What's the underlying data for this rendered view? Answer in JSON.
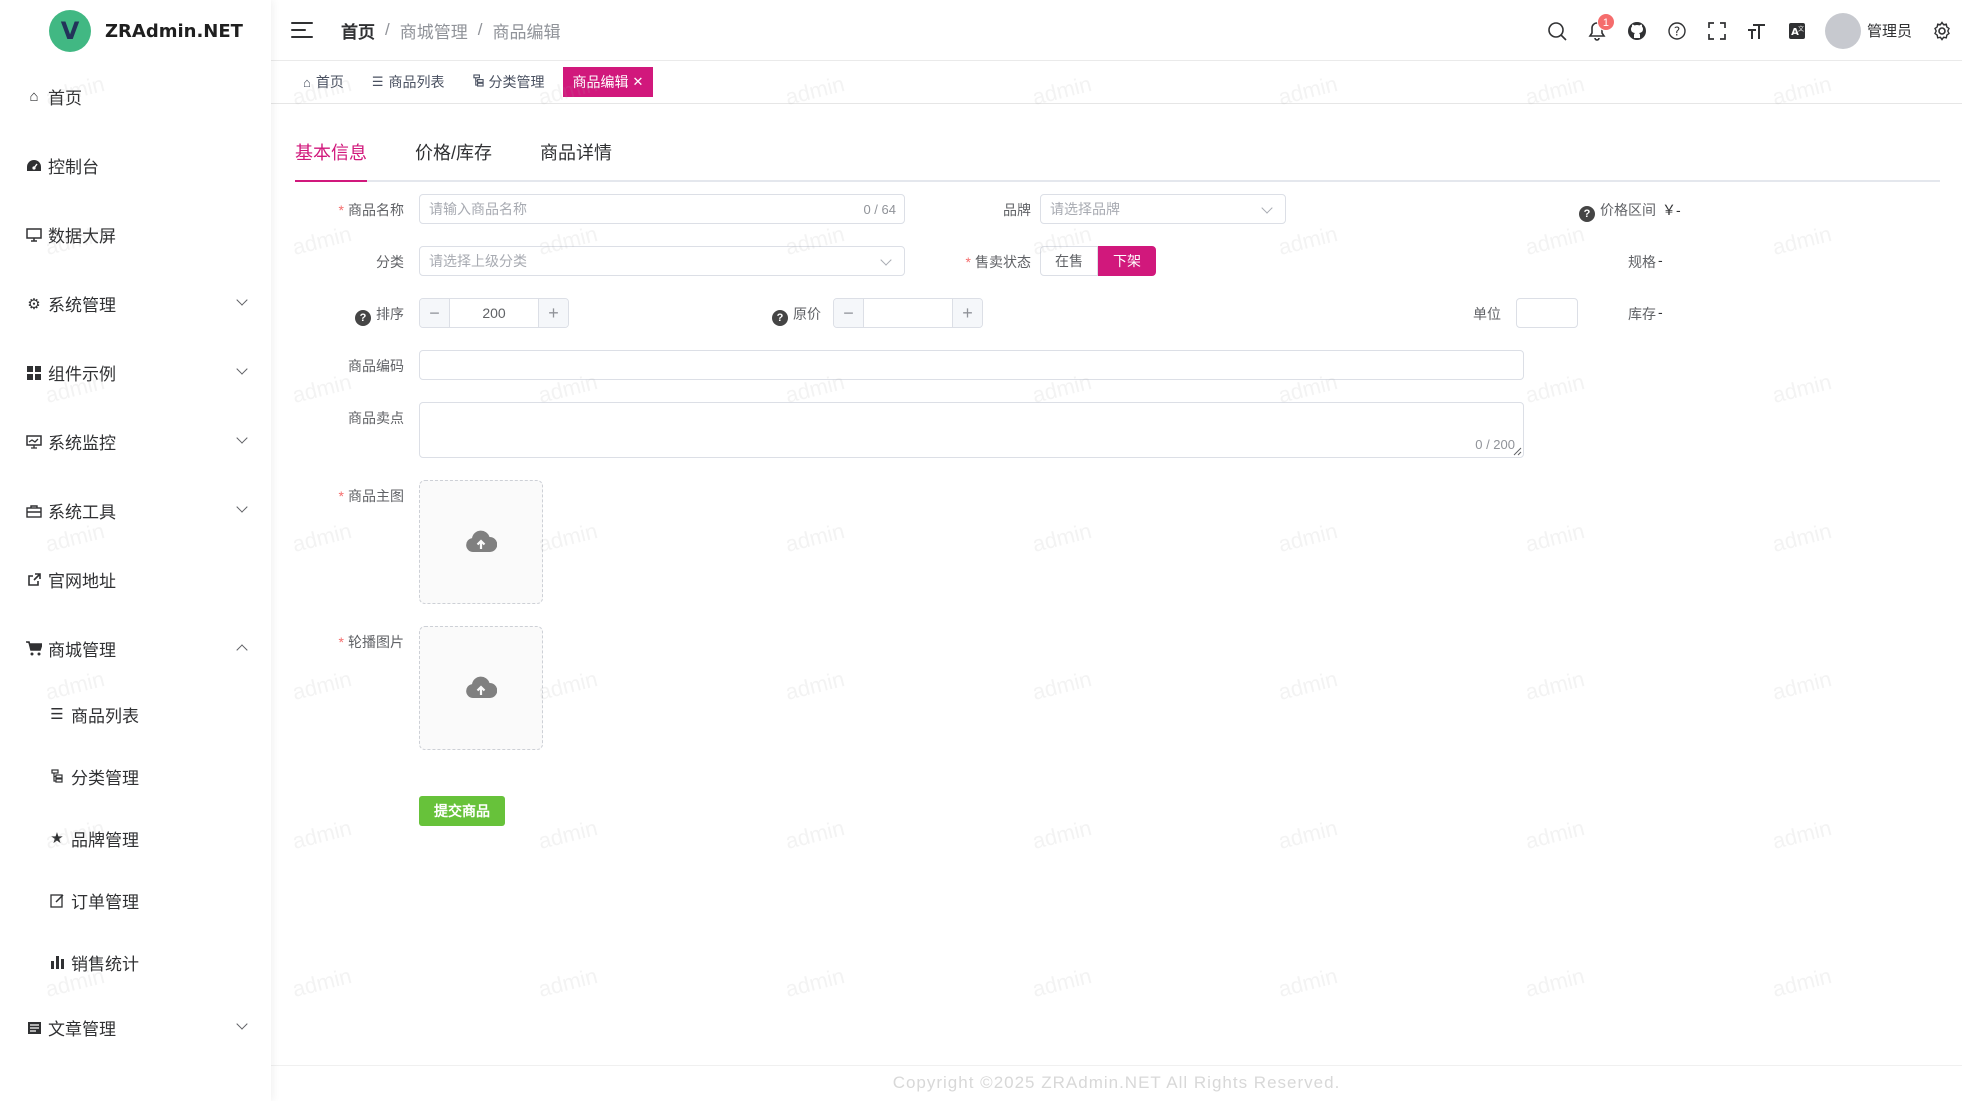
{
  "app": {
    "name": "ZRAdmin.NET",
    "logo_letter": "V",
    "brand_color": "#41b883",
    "accent_color": "#d1187c"
  },
  "sidebar": {
    "items": [
      {
        "label": "首页",
        "icon": "home-icon"
      },
      {
        "label": "控制台",
        "icon": "dashboard-icon"
      },
      {
        "label": "数据大屏",
        "icon": "monitor-icon"
      },
      {
        "label": "系统管理",
        "icon": "gear-icon",
        "expandable": true
      },
      {
        "label": "组件示例",
        "icon": "grid-icon",
        "expandable": true
      },
      {
        "label": "系统监控",
        "icon": "monitor-chart-icon",
        "expandable": true
      },
      {
        "label": "系统工具",
        "icon": "toolbox-icon",
        "expandable": true
      },
      {
        "label": "官网地址",
        "icon": "external-link-icon"
      },
      {
        "label": "商城管理",
        "icon": "cart-icon",
        "expandable": true,
        "expanded": true
      },
      {
        "label": "文章管理",
        "icon": "article-icon",
        "expandable": true
      }
    ],
    "mall_sub": [
      {
        "label": "商品列表",
        "icon": "list-icon"
      },
      {
        "label": "分类管理",
        "icon": "tree-icon"
      },
      {
        "label": "品牌管理",
        "icon": "star-icon"
      },
      {
        "label": "订单管理",
        "icon": "edit-icon"
      },
      {
        "label": "销售统计",
        "icon": "bar-chart-icon"
      }
    ]
  },
  "header": {
    "breadcrumb": [
      "首页",
      "商城管理",
      "商品编辑"
    ],
    "notification_count": "1",
    "username": "管理员"
  },
  "tags": [
    {
      "label": "首页",
      "icon": "home-icon"
    },
    {
      "label": "商品列表",
      "icon": "list-icon"
    },
    {
      "label": "分类管理",
      "icon": "tree-icon"
    },
    {
      "label": "商品编辑",
      "active": true
    }
  ],
  "form": {
    "tabs": [
      "基本信息",
      "价格/库存",
      "商品详情"
    ],
    "active_tab": "基本信息",
    "name_label": "商品名称",
    "name_placeholder": "请输入商品名称",
    "name_count": "0 / 64",
    "brand_label": "品牌",
    "brand_placeholder": "请选择品牌",
    "price_range_label": "价格区间",
    "price_range_value": "￥-",
    "category_label": "分类",
    "category_placeholder": "请选择上级分类",
    "sale_status_label": "售卖状态",
    "sale_status_options": [
      "在售",
      "下架"
    ],
    "sale_status_selected": "下架",
    "spec_label": "规格",
    "spec_value": "-",
    "sort_label": "排序",
    "sort_value": "200",
    "original_price_label": "原价",
    "original_price_value": "",
    "unit_label": "单位",
    "unit_value": "",
    "stock_label": "库存",
    "stock_value": "-",
    "code_label": "商品编码",
    "code_value": "",
    "selling_point_label": "商品卖点",
    "selling_point_count": "0 / 200",
    "main_image_label": "商品主图",
    "carousel_label": "轮播图片",
    "submit_label": "提交商品"
  },
  "footer": {
    "copyright": "Copyright ©2025 ZRAdmin.NET All Rights Reserved."
  },
  "watermark": "admin"
}
